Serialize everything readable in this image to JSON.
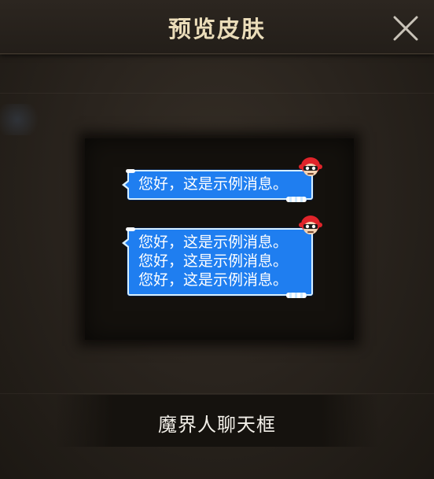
{
  "header": {
    "title": "预览皮肤",
    "close_icon": "close-x-icon"
  },
  "preview": {
    "bubbles": [
      {
        "lines": [
          "您好，这是示例消息。"
        ]
      },
      {
        "lines": [
          "您好，这是示例消息。",
          "您好，这是示例消息。",
          "您好，这是示例消息。"
        ]
      }
    ],
    "bubble_color": "#1f7ef0",
    "bubble_border_color": "#d8efff",
    "avatar_icon": "red-helmet-mascot-icon"
  },
  "skin": {
    "name": "魔界人聊天框"
  },
  "colors": {
    "title_text": "#eadcb9",
    "background": "#2a241e",
    "panel": "#14110d"
  }
}
